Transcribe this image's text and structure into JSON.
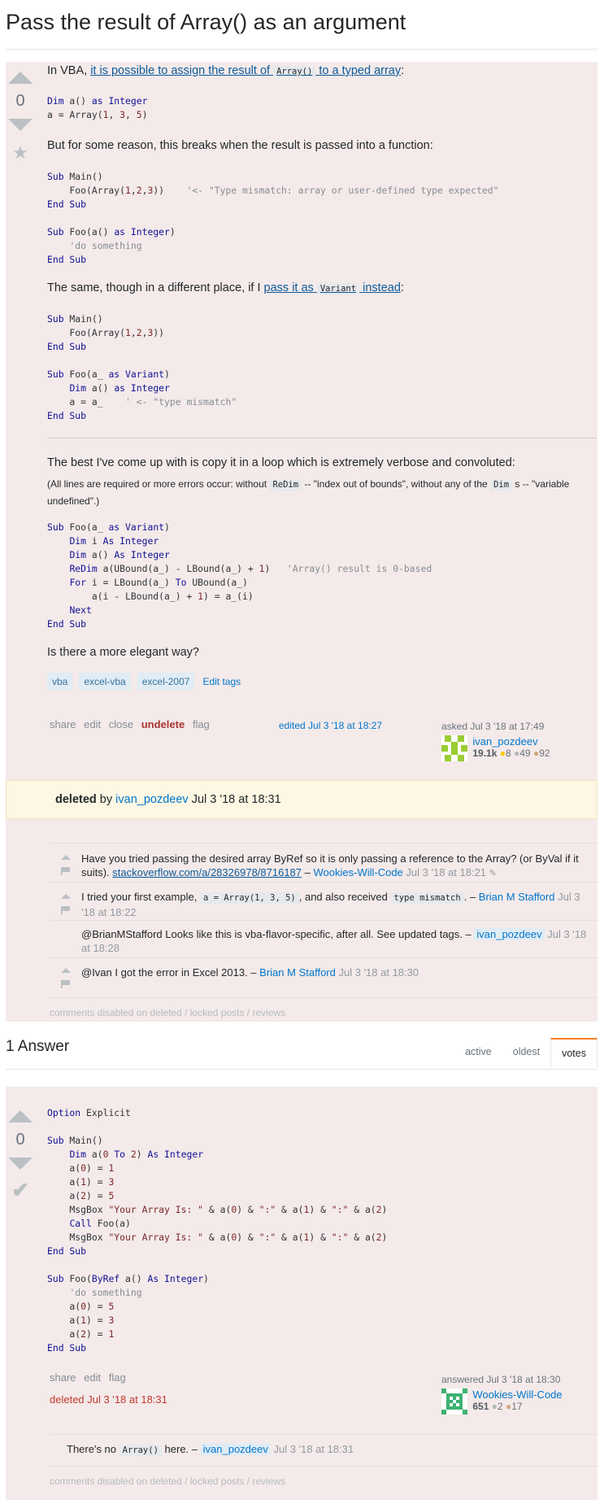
{
  "question": {
    "title": "Pass the result of Array() as an argument",
    "vote_count": "0",
    "intro_prefix": "In VBA,",
    "intro_link_pre": "it is possible to assign the result of",
    "intro_link_code": "Array()",
    "intro_link_post": "to a typed array",
    "intro_suffix": ":",
    "para2": "But for some reason, this breaks when the result is passed into a function:",
    "para3_prefix": "The same, though in a different place, if I",
    "para3_link_pre": "pass it as",
    "para3_link_code": "Variant",
    "para3_link_post": "instead",
    "para3_suffix": ":",
    "para4": "The best I've come up with is copy it in a loop which is extremely verbose and convoluted:",
    "note_1": "(All lines are required or more errors occur: without",
    "note_code1": "ReDim",
    "note_2": "-- \"index out of bounds\", without any of the",
    "note_code2": "Dim",
    "note_3": "s -- \"variable undefined\".)",
    "para5": "Is there a more elegant way?",
    "tags": [
      "vba",
      "excel-vba",
      "excel-2007"
    ],
    "edit_tags": "Edit tags",
    "menu": {
      "share": "share",
      "edit": "edit",
      "close": "close",
      "undelete": "undelete",
      "flag": "flag"
    },
    "edited": "edited Jul 3 '18 at 18:27",
    "asked": "asked Jul 3 '18 at 17:49",
    "owner": {
      "name": "ivan_pozdeev",
      "rep": "19.1k",
      "gold": "8",
      "silver": "49",
      "bronze": "92"
    },
    "deleted_label": "deleted",
    "deleted_by": "by",
    "deleted_user": "ivan_pozdeev",
    "deleted_date": "Jul 3 '18 at 18:31"
  },
  "comments": [
    {
      "text": "Have you tried passing the desired array ByRef so it is only passing a reference to the Array? (or ByVal if it suits).",
      "link": "stackoverflow.com/a/28326978/8716187",
      "dash": "–",
      "user": "Wookies-Will-Code",
      "date": "Jul 3 '18 at 18:21"
    },
    {
      "text_pre": "I tried your first example,",
      "code1": "a = Array(1, 3, 5)",
      "text_mid": ", and also received",
      "code2": "type mismatch",
      "text_post": ". –",
      "user": "Brian M Stafford",
      "date": "Jul 3 '18 at 18:22"
    },
    {
      "text": "@BrianMStafford Looks like this is vba-flavor-specific, after all. See updated tags. –",
      "user": "ivan_pozdeev",
      "date": "Jul 3 '18 at 18:28"
    },
    {
      "text": "@Ivan I got the error in Excel 2013. –",
      "user": "Brian M Stafford",
      "date": "Jul 3 '18 at 18:30"
    }
  ],
  "comments_disabled": "comments disabled on deleted / locked posts / reviews",
  "answers_header": "1 Answer",
  "tabs": [
    "active",
    "oldest",
    "votes"
  ],
  "answer": {
    "vote_count": "0",
    "menu": {
      "share": "share",
      "edit": "edit",
      "flag": "flag"
    },
    "deleted": "deleted Jul 3 '18 at 18:31",
    "answered": "answered Jul 3 '18 at 18:30",
    "owner": {
      "name": "Wookies-Will-Code",
      "rep": "651",
      "silver": "2",
      "bronze": "17"
    },
    "comment": {
      "pre": "There's no",
      "code": "Array()",
      "post": "here. –",
      "user": "ivan_pozdeev",
      "date": "Jul 3 '18 at 18:31"
    }
  },
  "colors": {
    "deleted_bg": "#f4eaea",
    "banner_bg": "#fdf7e3",
    "link": "#0c5a9a",
    "undelete": "#aa3333",
    "votes_tab_accent": "#f48024"
  }
}
